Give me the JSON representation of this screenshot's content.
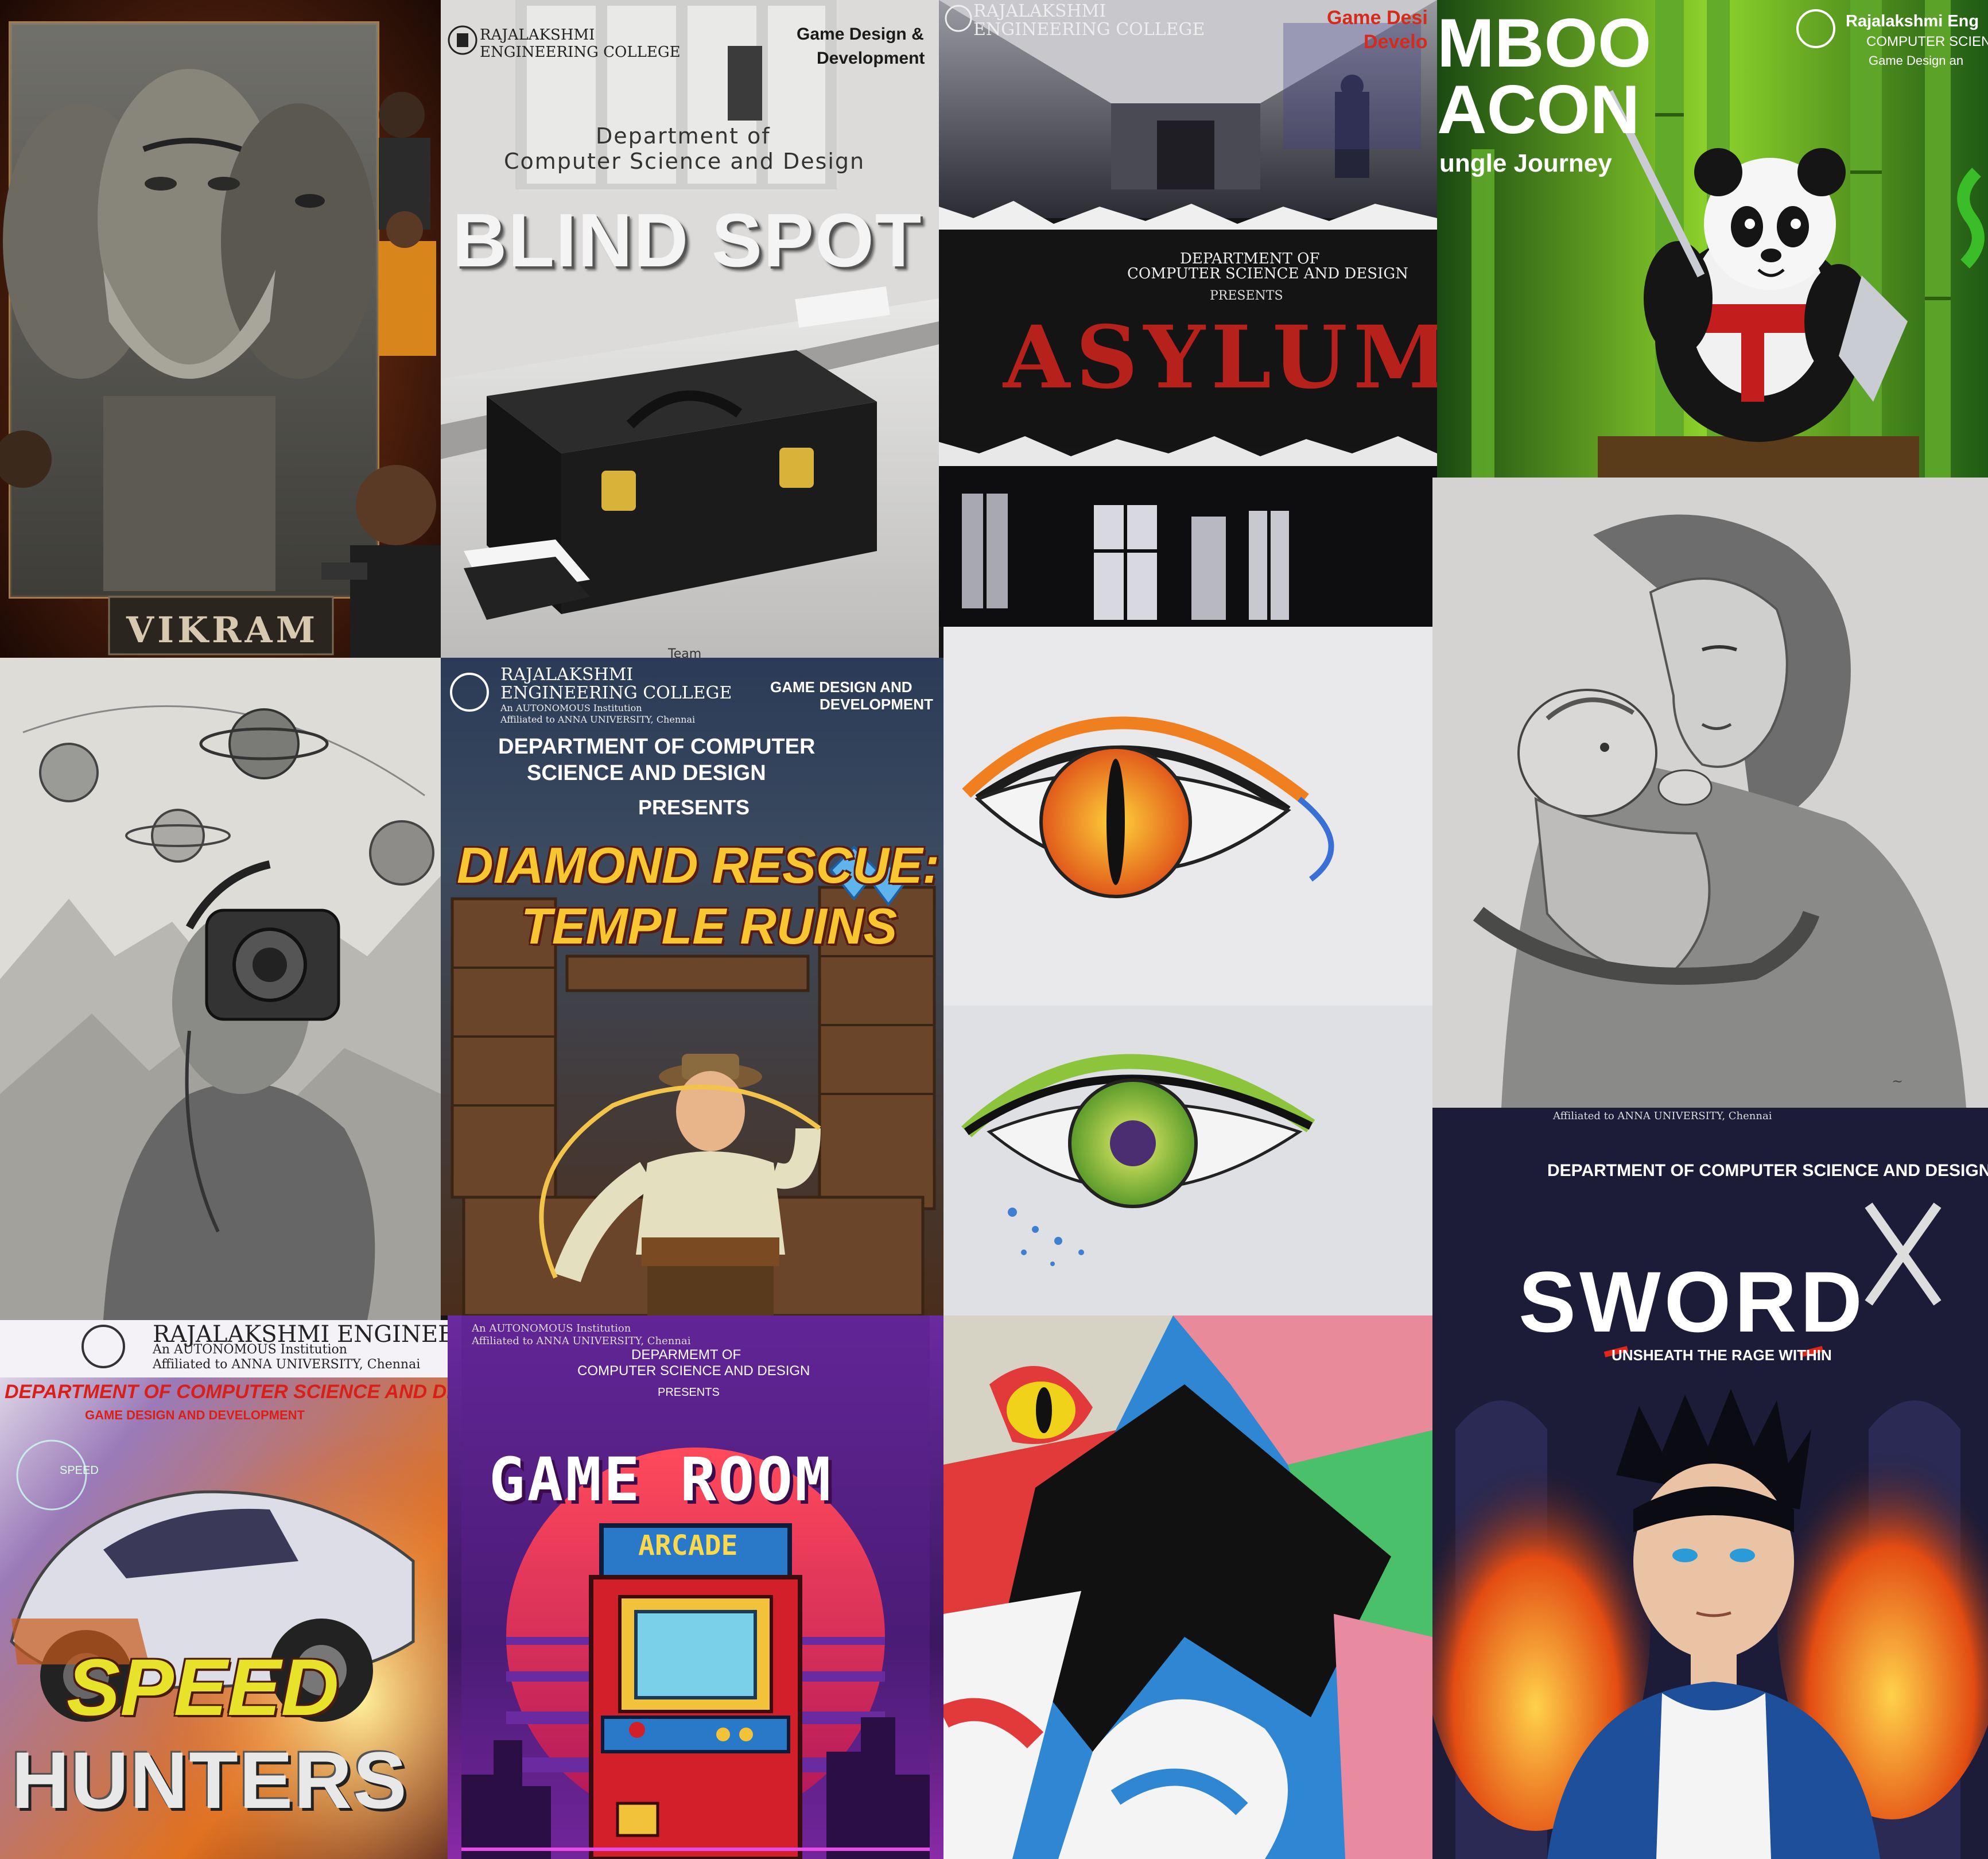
{
  "collage": {
    "vikram": {
      "title": "VIKRAM"
    },
    "blind_spot": {
      "college_line1": "RAJALAKSHMI",
      "college_line2": "ENGINEERING COLLEGE",
      "tagline_line1": "Game Design &",
      "tagline_line2": "Development",
      "dept_line1": "Department of",
      "dept_line2": "Computer Science and Design",
      "title": "BLIND SPOT",
      "footer": "Team"
    },
    "asylum": {
      "college_line1": "RAJALAKSHMI",
      "college_line2": "ENGINEERING COLLEGE",
      "tagline_line1": "Game Desi",
      "tagline_line2": "Develo",
      "dept_line1": "DEPARTMENT OF",
      "dept_line2": "COMPUTER SCIENCE AND DESIGN",
      "presents": "PRESENTS",
      "title": "ASYLUM"
    },
    "bamboo": {
      "college_line1": "Rajalakshmi Eng",
      "college_line2": "COMPUTER SCIENC",
      "college_line3": "Game Design an",
      "title_line1": "MBOO",
      "title_line2": "ACON",
      "subtitle": "ungle Journey"
    },
    "diamond": {
      "college_line1": "RAJALAKSHMI",
      "college_line2": "ENGINEERING COLLEGE",
      "college_line3": "An AUTONOMOUS Institution",
      "college_line4": "Affiliated to ANNA UNIVERSITY, Chennai",
      "tagline_line1": "GAME DESIGN AND",
      "tagline_line2": "DEVELOPMENT",
      "dept_line1": "DEPARTMENT OF COMPUTER",
      "dept_line2": "SCIENCE AND DESIGN",
      "presents": "PRESENTS",
      "title_line1": "DIAMOND RESCUE:",
      "title_line2": "TEMPLE RUINS"
    },
    "sword": {
      "top_note": "Affiliated to ANNA UNIVERSITY, Chennai",
      "dept": "DEPARTMENT OF COMPUTER SCIENCE AND DESIGN",
      "title": "SWORD",
      "subtitle": "UNSHEATH THE RAGE WITHIN"
    },
    "speed": {
      "college_line1": "RAJALAKSHMI ENGINEERING COLLEGE",
      "college_line2": "An AUTONOMOUS Institution",
      "college_line3": "Affiliated to ANNA UNIVERSITY, Chennai",
      "dept": "DEPARTMENT OF COMPUTER SCIENCE AND DESIGN",
      "sub": "GAME DESIGN AND DEVELOPMENT",
      "hud": "SPEED",
      "title_line1": "SPEED",
      "title_line2": "HUNTERS"
    },
    "game_room": {
      "college_line1": "An AUTONOMOUS Institution",
      "college_line2": "Affiliated to ANNA UNIVERSITY, Chennai",
      "dept_line1": "DEPARMEMT OF",
      "dept_line2": "COMPUTER SCIENCE AND DESIGN",
      "presents": "PRESENTS",
      "title": "GAME ROOM",
      "arcade": "ARCADE"
    }
  },
  "colors": {
    "asylum_red": "#b7211b",
    "diamond_gold": "#f7c631",
    "speed_yellow": "#e9e22b",
    "game_room_sun": "#f04a4a",
    "panda_belt": "#c41d1d"
  }
}
